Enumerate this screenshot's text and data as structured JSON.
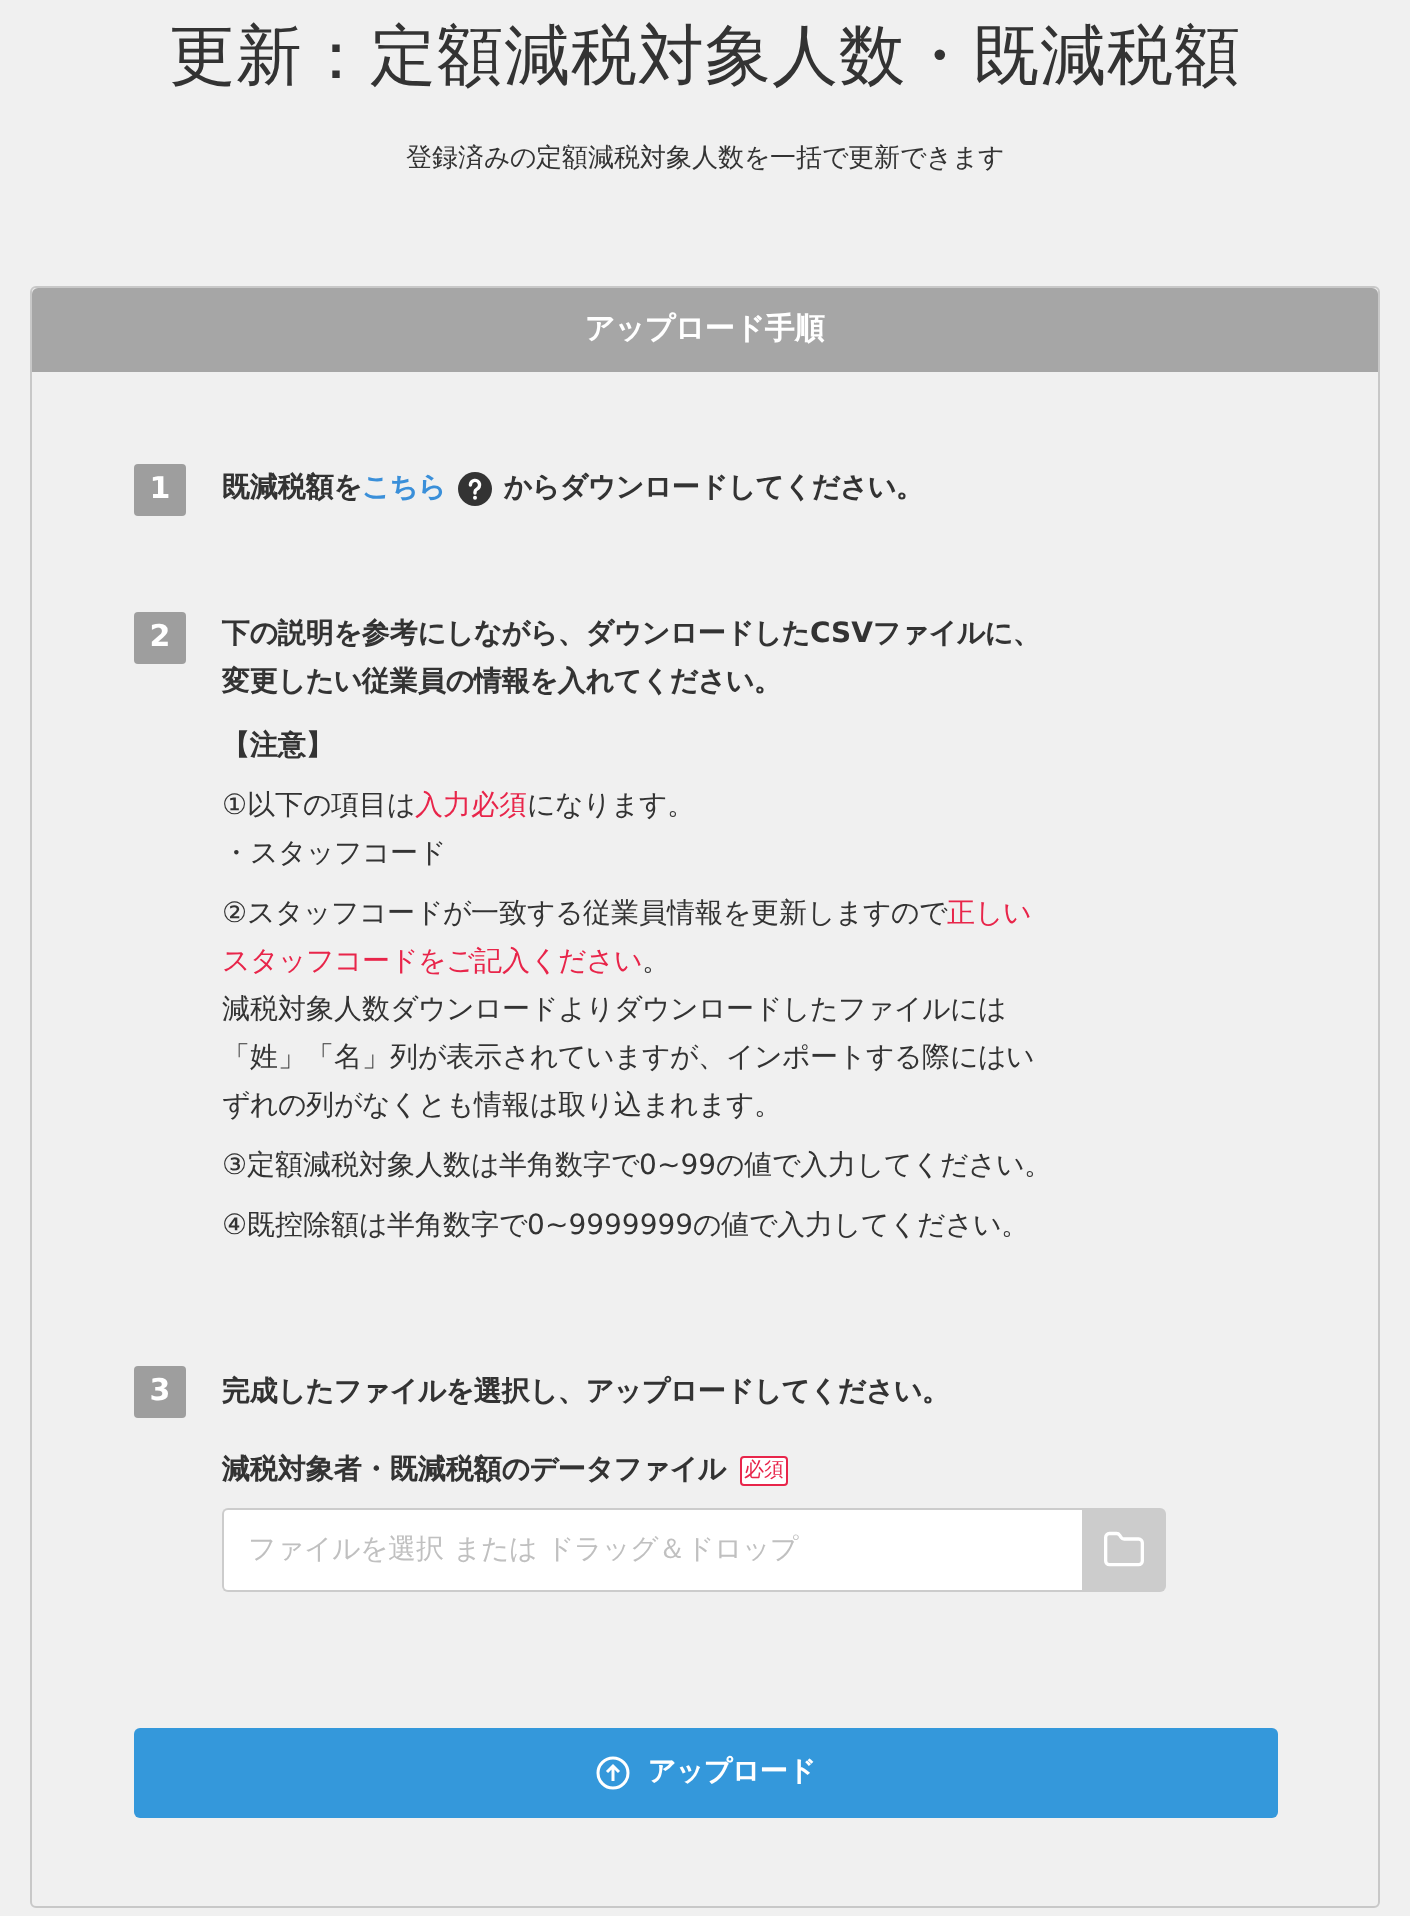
{
  "title": "更新：定額減税対象人数・既減税額",
  "subtitle": "登録済みの定額減税対象人数を一括で更新できます",
  "card": {
    "header": "アップロード手順",
    "step1": {
      "number": "1",
      "before": "既減税額を",
      "link": "こちら",
      "after": "からダウンロードしてください。"
    },
    "step2": {
      "number": "2",
      "lines": [
        "下の説明を参考にしながら、ダウンロードしたCSVファイルに、",
        "変更したい従業員の情報を入れてください。"
      ],
      "notes_heading": "【注意】",
      "notes": [
        [
          [
            {
              "text": "①以下の項目は",
              "emphasis": false
            },
            {
              "text": "入力必須",
              "emphasis": true
            },
            {
              "text": "になります。",
              "emphasis": false
            }
          ],
          [
            {
              "text": "・スタッフコード",
              "emphasis": false
            }
          ]
        ],
        [
          [
            {
              "text": "②スタッフコードが一致する従業員情報を更新しますので",
              "emphasis": false
            },
            {
              "text": "正しい",
              "emphasis": true
            }
          ],
          [
            {
              "text": "スタッフコードをご記入ください",
              "emphasis": true
            },
            {
              "text": "。",
              "emphasis": false
            }
          ],
          [
            {
              "text": "減税対象人数ダウンロードよりダウンロードしたファイルには",
              "emphasis": false
            }
          ],
          [
            {
              "text": "「姓」「名」列が表示されていますが、インポートする際にはい",
              "emphasis": false
            }
          ],
          [
            {
              "text": "ずれの列がなくとも情報は取り込まれます。",
              "emphasis": false
            }
          ]
        ],
        [
          [
            {
              "text": "③定額減税対象人数は半角数字で0~99の値で入力してください。",
              "emphasis": false
            }
          ]
        ],
        [
          [
            {
              "text": "④既控除額は半角数字で0~9999999の値で入力してください。",
              "emphasis": false
            }
          ]
        ]
      ]
    },
    "step3": {
      "number": "3",
      "text": "完成したファイルを選択し、アップロードしてください。",
      "field_label": "減税対象者・既減税額のデータファイル",
      "required_badge": "必須",
      "placeholder": "ファイルを選択 または ドラッグ＆ドロップ"
    },
    "upload_button": "アップロード"
  }
}
